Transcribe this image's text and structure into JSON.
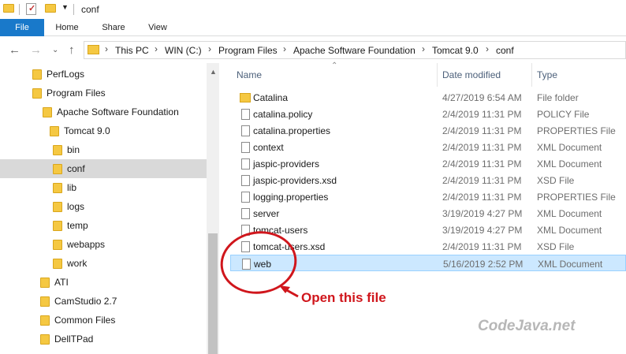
{
  "window": {
    "title": "conf"
  },
  "ribbon": {
    "tabs": [
      "File",
      "Home",
      "Share",
      "View"
    ]
  },
  "address": {
    "crumbs": [
      "This PC",
      "WIN (C:)",
      "Program Files",
      "Apache Software Foundation",
      "Tomcat 9.0",
      "conf"
    ]
  },
  "nav": {
    "items": [
      "PerfLogs",
      "Program Files",
      "Apache Software Foundation",
      "Tomcat 9.0",
      "bin",
      "conf",
      "lib",
      "logs",
      "temp",
      "webapps",
      "work",
      "ATI",
      "CamStudio 2.7",
      "Common Files",
      "DellTPad"
    ],
    "selected": "conf"
  },
  "columns": {
    "name": "Name",
    "date": "Date modified",
    "type": "Type"
  },
  "files": [
    {
      "name": "Catalina",
      "date": "4/27/2019 6:54 AM",
      "type": "File folder",
      "icon": "folder"
    },
    {
      "name": "catalina.policy",
      "date": "2/4/2019 11:31 PM",
      "type": "POLICY File",
      "icon": "file"
    },
    {
      "name": "catalina.properties",
      "date": "2/4/2019 11:31 PM",
      "type": "PROPERTIES File",
      "icon": "file"
    },
    {
      "name": "context",
      "date": "2/4/2019 11:31 PM",
      "type": "XML Document",
      "icon": "file"
    },
    {
      "name": "jaspic-providers",
      "date": "2/4/2019 11:31 PM",
      "type": "XML Document",
      "icon": "file"
    },
    {
      "name": "jaspic-providers.xsd",
      "date": "2/4/2019 11:31 PM",
      "type": "XSD File",
      "icon": "file"
    },
    {
      "name": "logging.properties",
      "date": "2/4/2019 11:31 PM",
      "type": "PROPERTIES File",
      "icon": "file"
    },
    {
      "name": "server",
      "date": "3/19/2019 4:27 PM",
      "type": "XML Document",
      "icon": "file"
    },
    {
      "name": "tomcat-users",
      "date": "3/19/2019 4:27 PM",
      "type": "XML Document",
      "icon": "file"
    },
    {
      "name": "tomcat-users.xsd",
      "date": "2/4/2019 11:31 PM",
      "type": "XSD File",
      "icon": "file"
    },
    {
      "name": "web",
      "date": "5/16/2019 2:52 PM",
      "type": "XML Document",
      "icon": "file",
      "selected": true
    }
  ],
  "annotation": {
    "text": "Open this file",
    "color": "#d0161c"
  },
  "watermark": {
    "text": "CodeJava.net"
  },
  "colors": {
    "accent": "#1979ca",
    "folder": "#f5c842",
    "selection": "#cce8ff"
  }
}
